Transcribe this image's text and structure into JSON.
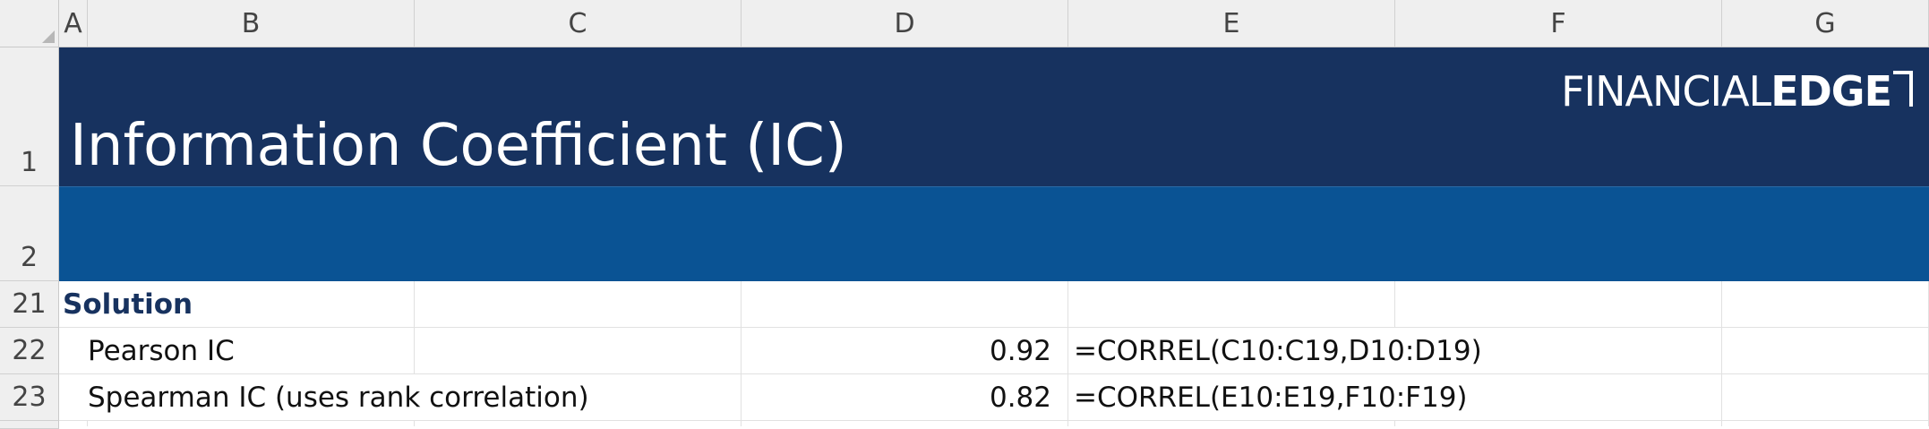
{
  "columns": [
    "A",
    "B",
    "C",
    "D",
    "E",
    "F",
    "G"
  ],
  "rows": [
    "1",
    "2",
    "21",
    "22",
    "23"
  ],
  "title": "Information Coefficient (IC)",
  "logo": {
    "part1": "FINANCIAL",
    "part2": "EDGE"
  },
  "solution_heading": "Solution",
  "items": [
    {
      "label": "Pearson IC",
      "value": "0.92",
      "formula": "=CORREL(C10:C19,D10:D19)"
    },
    {
      "label": "Spearman IC (uses rank correlation)",
      "value": "0.82",
      "formula": "=CORREL(E10:E19,F10:F19)"
    }
  ],
  "colors": {
    "header_dark": "#17325f",
    "header_band": "#0a5394",
    "heading_text": "#17325f"
  }
}
